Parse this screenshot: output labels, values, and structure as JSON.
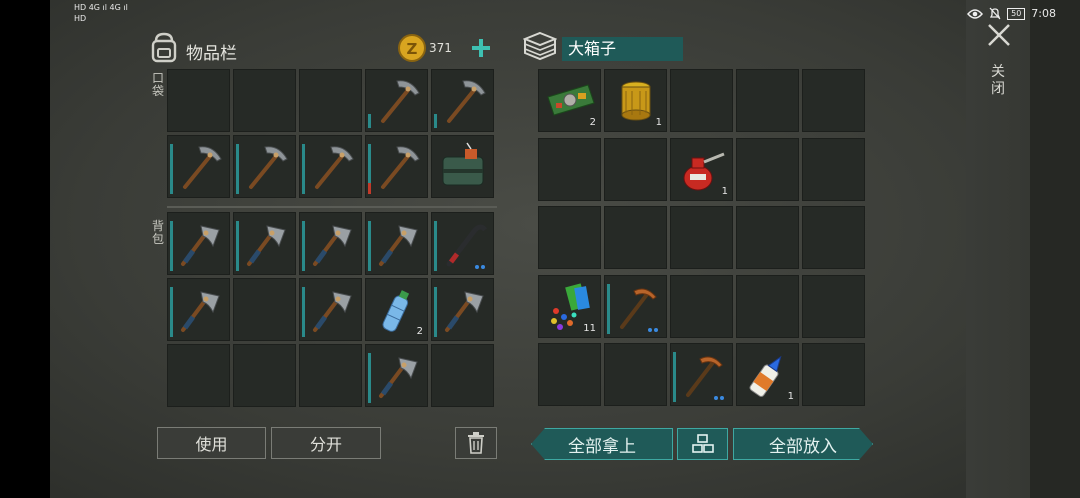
{
  "status_bar": {
    "left_top": "HD 4G ıl 4G ıl",
    "left_bottom": "HD",
    "battery": "50",
    "time": "7:08"
  },
  "inventory": {
    "title": "物品栏",
    "coins": "371",
    "pocket_label": "口袋",
    "backpack_label": "背包",
    "pocket_cells": [
      {
        "item": "",
        "count": ""
      },
      {
        "item": "",
        "count": ""
      },
      {
        "item": "",
        "count": ""
      },
      {
        "item": "pickaxe",
        "count": "",
        "bar": 0.25
      },
      {
        "item": "pickaxe",
        "count": "",
        "bar": 0.25
      },
      {
        "item": "pickaxe",
        "count": "",
        "bar": 0.9
      },
      {
        "item": "pickaxe",
        "count": "",
        "bar": 0.9
      },
      {
        "item": "pickaxe",
        "count": "",
        "bar": 0.9
      },
      {
        "item": "pickaxe",
        "count": "",
        "bar": 0.9,
        "bar_red": 0.2
      },
      {
        "item": "bomb-bag",
        "count": ""
      }
    ],
    "backpack_cells": [
      {
        "item": "axe",
        "count": "",
        "bar": 0.9
      },
      {
        "item": "axe",
        "count": "",
        "bar": 0.9
      },
      {
        "item": "axe",
        "count": "",
        "bar": 0.9
      },
      {
        "item": "axe",
        "count": "",
        "bar": 0.9
      },
      {
        "item": "crowbar",
        "count": "",
        "bar": 0.9,
        "dots": true
      },
      {
        "item": "axe",
        "count": "",
        "bar": 0.9
      },
      {
        "item": "",
        "count": ""
      },
      {
        "item": "axe",
        "count": "",
        "bar": 0.9
      },
      {
        "item": "water-bottle",
        "count": "2"
      },
      {
        "item": "axe",
        "count": "",
        "bar": 0.9
      },
      {
        "item": "",
        "count": ""
      },
      {
        "item": "",
        "count": ""
      },
      {
        "item": "",
        "count": ""
      },
      {
        "item": "axe",
        "count": "",
        "bar": 0.9
      },
      {
        "item": "",
        "count": ""
      }
    ],
    "use_label": "使用",
    "split_label": "分开"
  },
  "chest": {
    "name": "大箱子",
    "cells": [
      {
        "item": "circuit-board",
        "count": "2"
      },
      {
        "item": "oil-filter",
        "count": "1"
      },
      {
        "item": "",
        "count": ""
      },
      {
        "item": "",
        "count": ""
      },
      {
        "item": "",
        "count": ""
      },
      {
        "item": "",
        "count": ""
      },
      {
        "item": "",
        "count": ""
      },
      {
        "item": "oil-can",
        "count": "1"
      },
      {
        "item": "",
        "count": ""
      },
      {
        "item": "",
        "count": ""
      },
      {
        "item": "",
        "count": ""
      },
      {
        "item": "",
        "count": ""
      },
      {
        "item": "",
        "count": ""
      },
      {
        "item": "",
        "count": ""
      },
      {
        "item": "",
        "count": ""
      },
      {
        "item": "scrap-parts",
        "count": "11"
      },
      {
        "item": "copper-pickaxe",
        "count": "",
        "bar": 0.9,
        "dots": true
      },
      {
        "item": "",
        "count": ""
      },
      {
        "item": "",
        "count": ""
      },
      {
        "item": "",
        "count": ""
      },
      {
        "item": "",
        "count": ""
      },
      {
        "item": "",
        "count": ""
      },
      {
        "item": "copper-pickaxe",
        "count": "",
        "bar": 0.9,
        "dots": true
      },
      {
        "item": "glue",
        "count": "1"
      },
      {
        "item": "",
        "count": ""
      }
    ],
    "take_all_label": "全部拿上",
    "put_all_label": "全部放入"
  },
  "close_label": "关闭",
  "colors": {
    "accent": "#1f5a58",
    "accent_border": "#3ea8a2",
    "durability": "#2a8a8a"
  }
}
